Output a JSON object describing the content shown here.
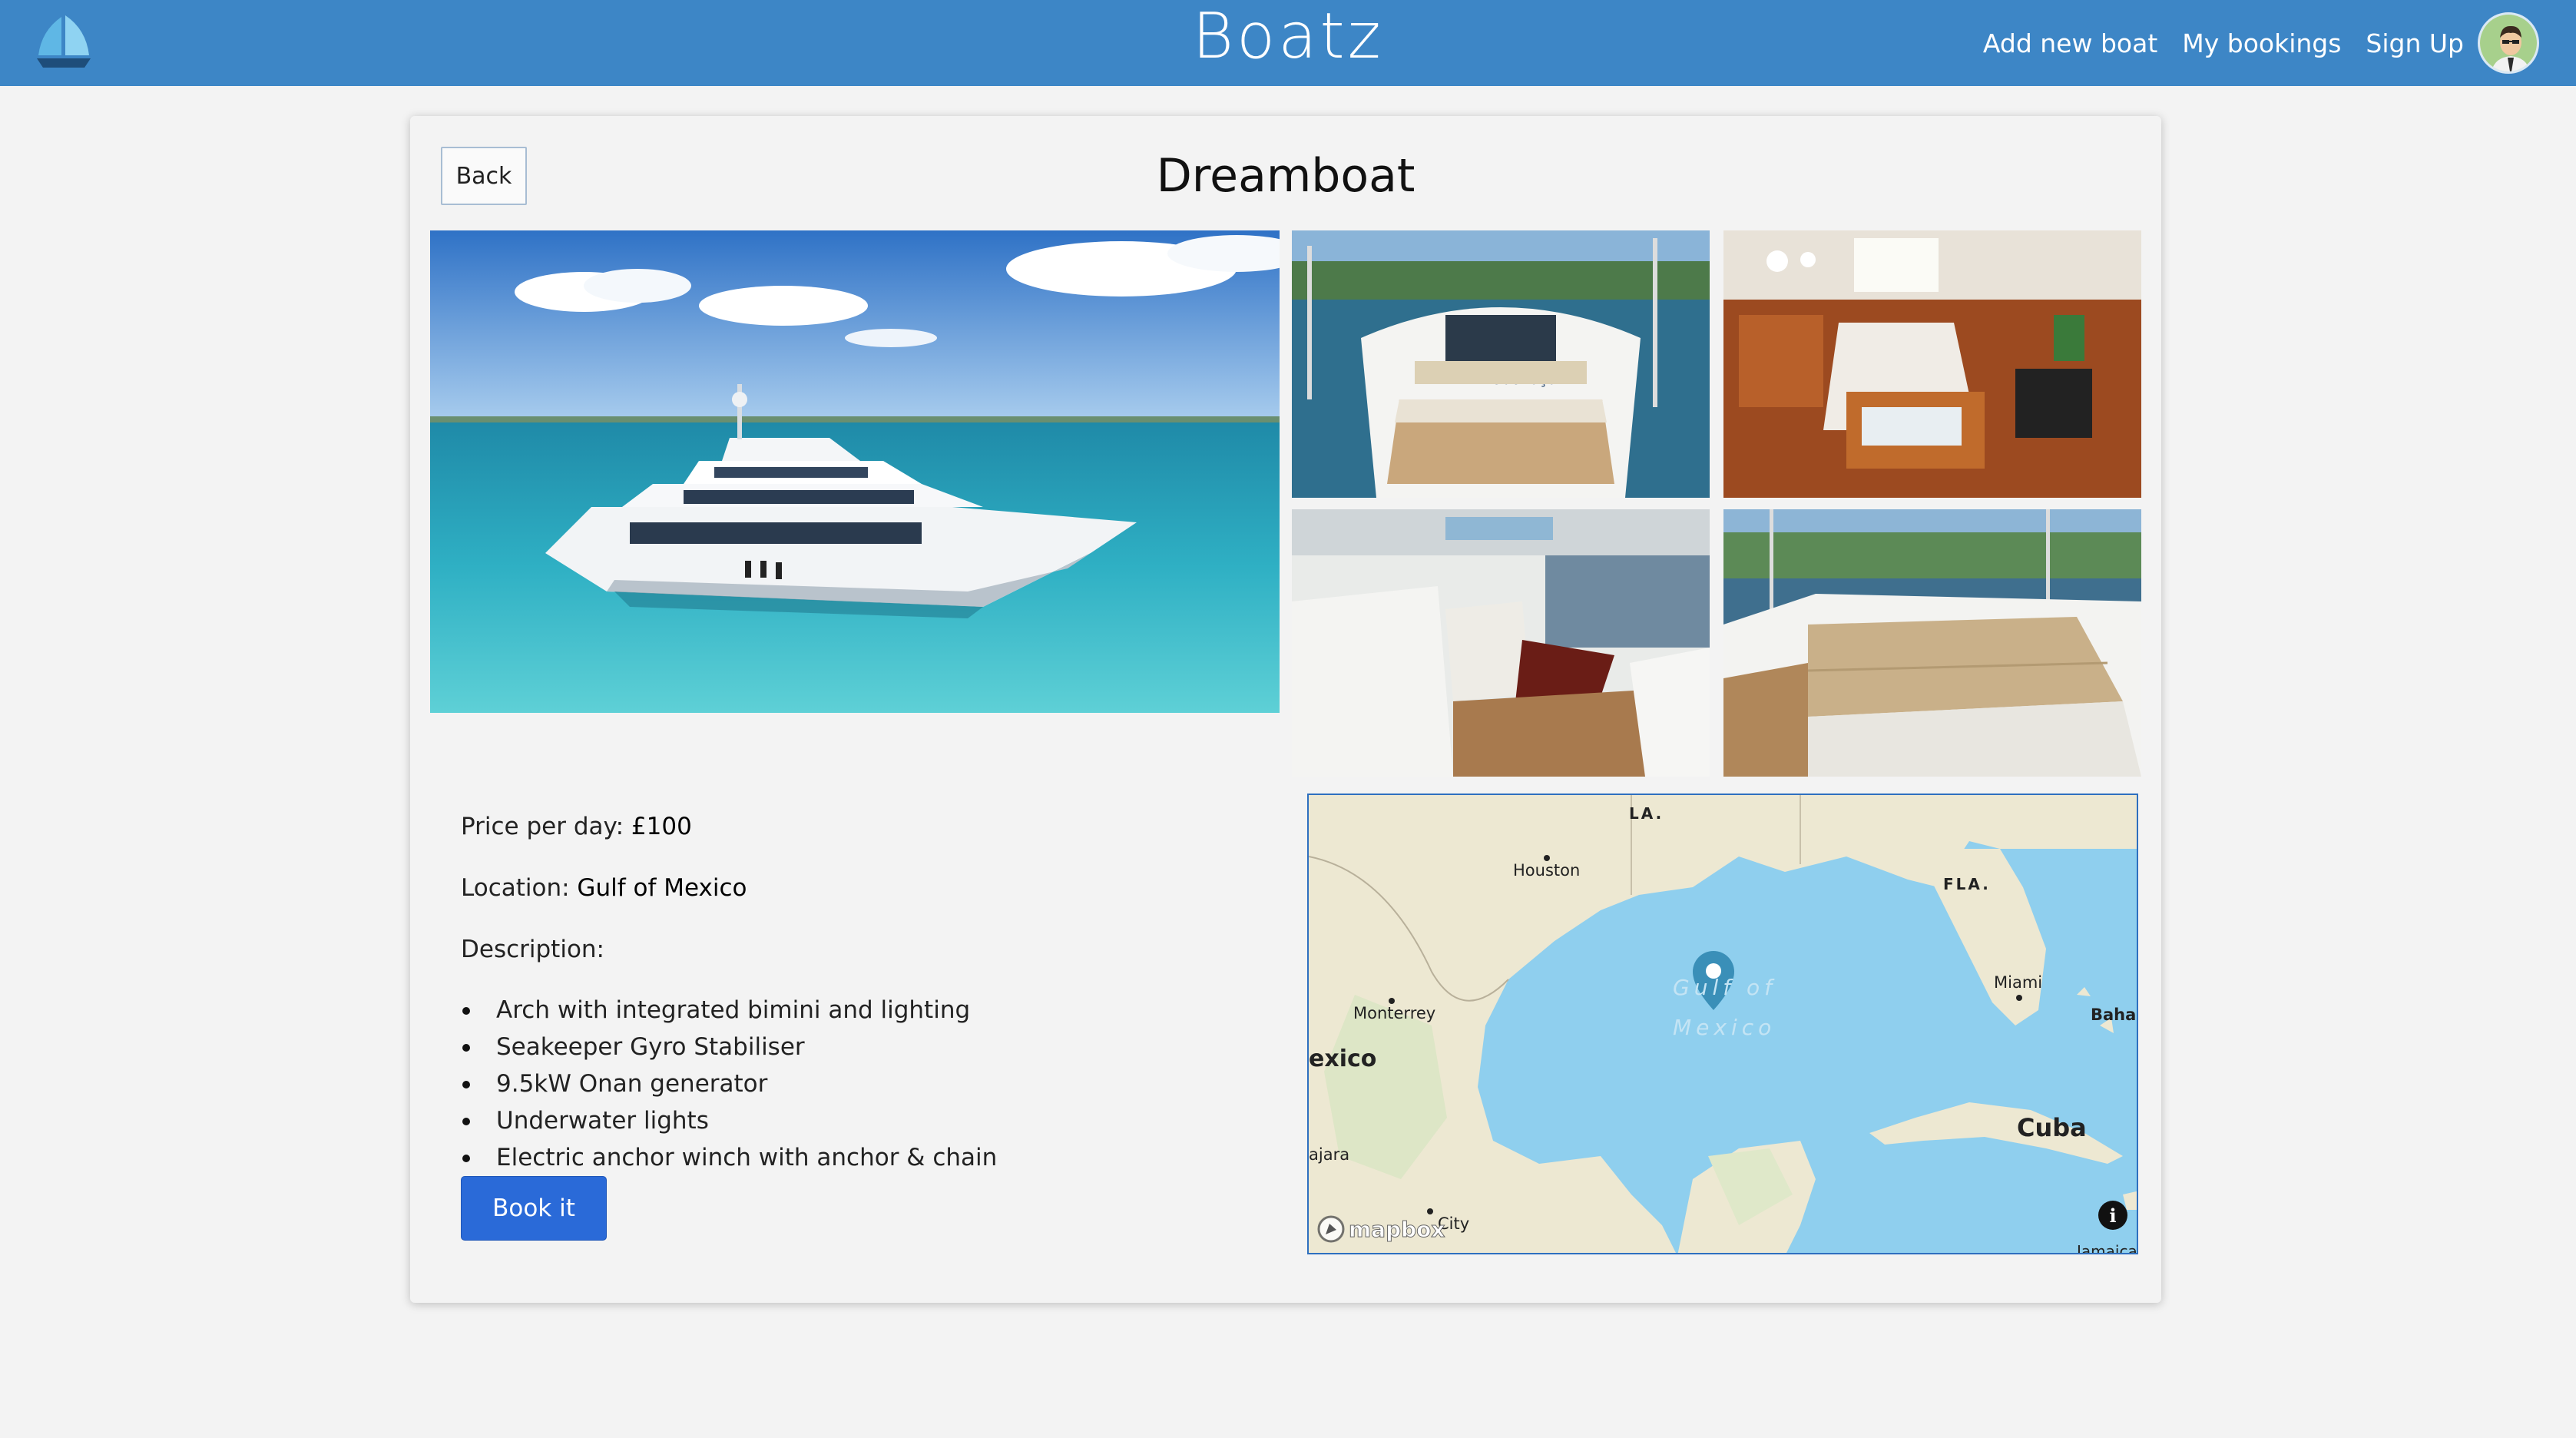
{
  "navbar": {
    "brand": "Boatz",
    "links": [
      "Add new boat",
      "My bookings",
      "Sign Up"
    ],
    "logo_icon": "sailboat-icon",
    "avatar_icon": "user-avatar",
    "background": "#3d86c6"
  },
  "page": {
    "back_label": "Back",
    "title": "Dreamboat"
  },
  "details": {
    "price_label": "Price per day:",
    "price_value": "£100",
    "location_label": "Location:",
    "location_value": "Gulf of Mexico",
    "description_label": "Description:",
    "features": [
      "Arch with integrated bimini and lighting",
      "Seakeeper Gyro Stabiliser",
      "9.5kW Onan generator",
      "Underwater lights",
      "Electric anchor winch with anchor & chain"
    ],
    "book_label": "Book it"
  },
  "map": {
    "labels": {
      "la": "LA.",
      "houston": "Houston",
      "fla": "FLA.",
      "miami": "Miami",
      "monterrey": "Monterrey",
      "gulf_line1": "Gulf of",
      "gulf_line2": "Mexico",
      "bahamas": "Baha",
      "mexico": "exico",
      "cuba": "Cuba",
      "guadalajara": "ajara",
      "mexico_city": "City",
      "jamaica": "Jamaica",
      "attribution": "mapbox"
    },
    "marker_icon": "map-pin-icon",
    "info_icon": "info-icon"
  },
  "colors": {
    "accent": "#2a6ad8",
    "ocean": "#8fcfee",
    "land": "#ede8d2"
  }
}
